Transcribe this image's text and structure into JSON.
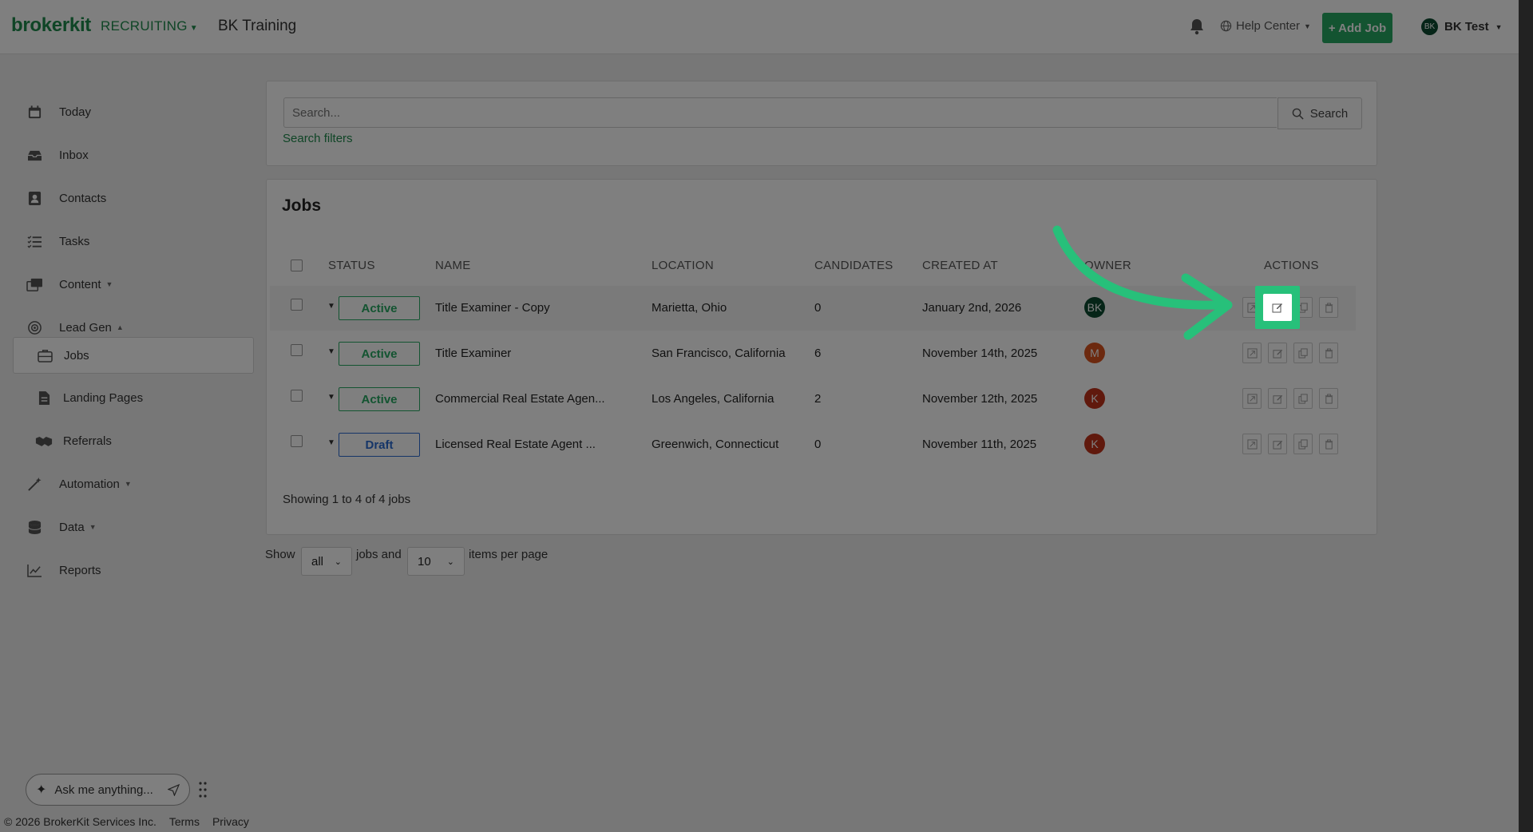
{
  "topbar": {
    "logo": "brokerkit",
    "module": "RECRUITING",
    "org": "BK Training",
    "help": "Help Center",
    "add_job": "+ Add Job",
    "user_initials": "BK",
    "user_name": "BK Test"
  },
  "sidebar": {
    "items": [
      {
        "label": "Today",
        "icon": "calendar-icon"
      },
      {
        "label": "Inbox",
        "icon": "inbox-icon"
      },
      {
        "label": "Contacts",
        "icon": "contacts-icon"
      },
      {
        "label": "Tasks",
        "icon": "tasks-icon"
      },
      {
        "label": "Content",
        "icon": "content-icon"
      },
      {
        "label": "Lead Gen",
        "icon": "lead-gen-icon"
      },
      {
        "label": "Jobs",
        "icon": "briefcase-icon"
      },
      {
        "label": "Landing Pages",
        "icon": "document-icon"
      },
      {
        "label": "Referrals",
        "icon": "handshake-icon"
      },
      {
        "label": "Automation",
        "icon": "magic-wand-icon"
      },
      {
        "label": "Data",
        "icon": "database-icon"
      },
      {
        "label": "Reports",
        "icon": "chart-icon"
      }
    ]
  },
  "search": {
    "placeholder": "Search...",
    "button": "Search",
    "filters": "Search filters"
  },
  "jobs": {
    "title": "Jobs",
    "columns": [
      "STATUS",
      "NAME",
      "LOCATION",
      "CANDIDATES",
      "CREATED AT",
      "OWNER",
      "ACTIONS"
    ],
    "rows": [
      {
        "status": "Active",
        "name": "Title Examiner - Copy",
        "location": "Marietta, Ohio",
        "candidates": "0",
        "created": "January 2nd, 2026",
        "owner": "BK",
        "owner_color": "#0d4a30"
      },
      {
        "status": "Active",
        "name": "Title Examiner",
        "location": "San Francisco, California",
        "candidates": "6",
        "created": "November 14th, 2025",
        "owner": "M",
        "owner_color": "#d9531e"
      },
      {
        "status": "Active",
        "name": "Commercial Real Estate Agen...",
        "location": "Los Angeles, California",
        "candidates": "2",
        "created": "November 12th, 2025",
        "owner": "K",
        "owner_color": "#c0321a"
      },
      {
        "status": "Draft",
        "name": "Licensed Real Estate Agent ...",
        "location": "Greenwich, Connecticut",
        "candidates": "0",
        "created": "November 11th, 2025",
        "owner": "K",
        "owner_color": "#c0321a"
      }
    ],
    "showing": "Showing 1 to 4 of 4 jobs"
  },
  "pager": {
    "show": "Show",
    "filter_value": "all",
    "jobs_and": "jobs and",
    "per_page_value": "10",
    "items_per_page": "items per page"
  },
  "assistant": {
    "placeholder": "Ask me anything..."
  },
  "footer": {
    "copyright": "© 2026 BrokerKit Services Inc.",
    "terms": "Terms",
    "privacy": "Privacy"
  },
  "colors": {
    "brand": "#1f8a4c",
    "button": "#27a862",
    "highlight": "#27c07a",
    "draft": "#2a6bd1"
  }
}
